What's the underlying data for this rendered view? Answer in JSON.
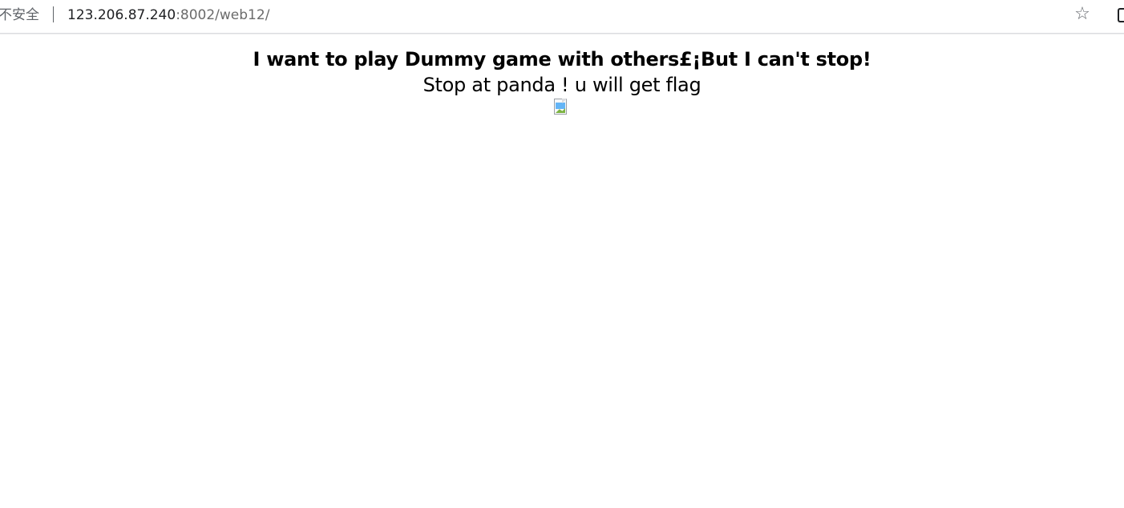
{
  "browser": {
    "security_label": "不安全",
    "url_host": "123.206.87.240",
    "url_rest": ":8002/web12/",
    "bookmark_icon": "star-icon"
  },
  "page": {
    "heading": "I want to play Dummy game with others£¡But I can't stop!",
    "subtext": "Stop at panda ! u will get flag",
    "image_icon": "broken-image-icon"
  }
}
